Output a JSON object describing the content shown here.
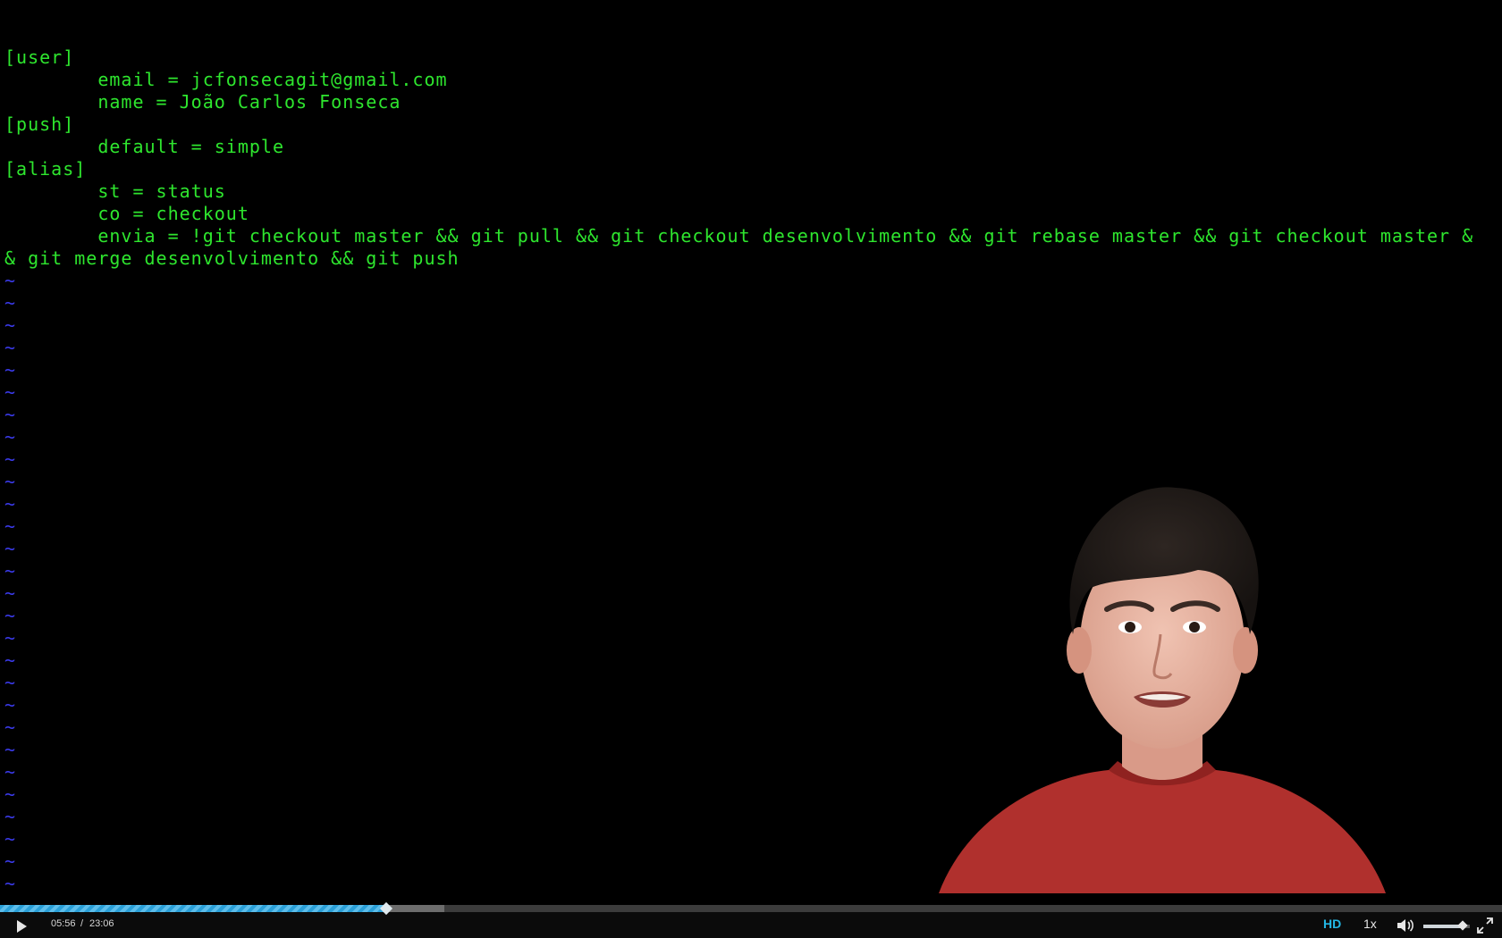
{
  "editor": {
    "lines": [
      "[user]",
      "        email = jcfonsecagit@gmail.com",
      "        name = João Carlos Fonseca",
      "[push]",
      "        default = simple",
      "[alias]",
      "        st = status",
      "        co = checkout",
      "        envia = !git checkout master && git pull && git checkout desenvolvimento && git rebase master && git checkout master &",
      "& git merge desenvolvimento && git push"
    ],
    "empty_line_marker": "~",
    "empty_line_count": 28
  },
  "player": {
    "current_time": "05:56",
    "time_separator": "/",
    "duration": "23:06",
    "progress_fraction": 0.257,
    "buffered_fraction": 0.296,
    "quality_label": "HD",
    "speed_label": "1x",
    "volume_fraction": 0.85
  },
  "colors": {
    "text": "#2ee62e",
    "tilde": "#3a3ae8",
    "progress": "#2aa0d8",
    "hd": "#23b8e6"
  }
}
